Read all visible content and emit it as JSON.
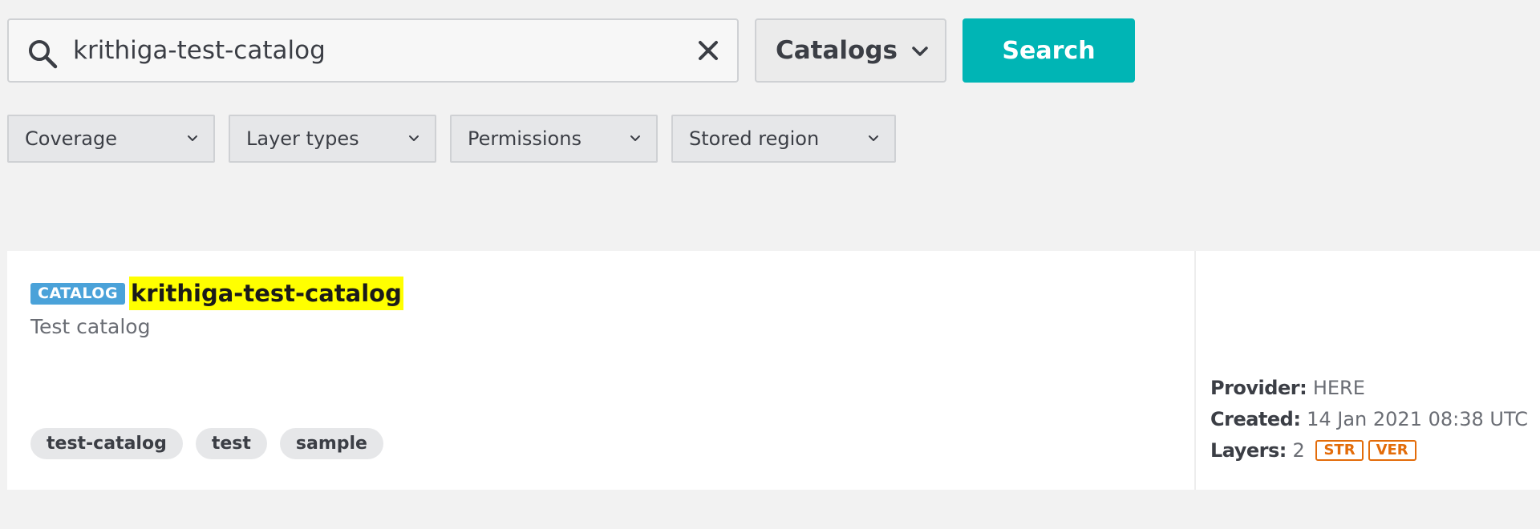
{
  "search": {
    "query": "krithiga-test-catalog",
    "type_select": "Catalogs",
    "button_label": "Search"
  },
  "filters": [
    "Coverage",
    "Layer types",
    "Permissions",
    "Stored region"
  ],
  "result": {
    "badge": "CATALOG",
    "title": "krithiga-test-catalog",
    "description": "Test catalog",
    "tags": [
      "test-catalog",
      "test",
      "sample"
    ],
    "provider_label": "Provider:",
    "provider": "HERE",
    "created_label": "Created:",
    "created": "14 Jan 2021 08:38 UTC",
    "layers_label": "Layers:",
    "layers": "2",
    "layer_types": [
      "STR",
      "VER"
    ]
  },
  "colors": {
    "accent": "#00b5b5",
    "badge": "#4aa2d9",
    "highlight": "#ffff00",
    "layer_badge": "#e36c0a"
  },
  "icons": {
    "search": "search-icon",
    "clear": "close-icon",
    "dropdown": "chevron-down-icon"
  }
}
